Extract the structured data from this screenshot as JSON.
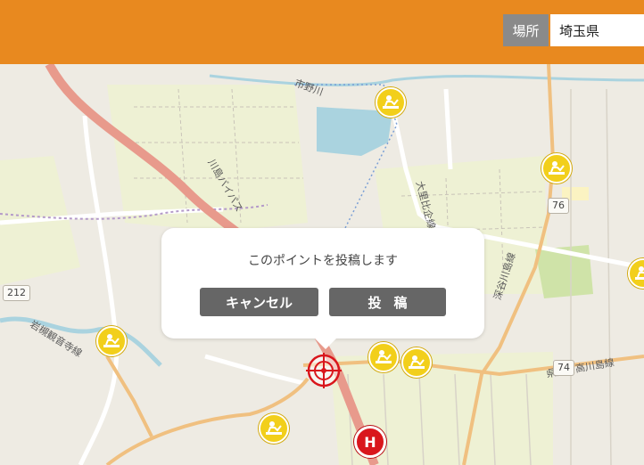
{
  "header": {
    "location_label": "場所",
    "location_value": "埼玉県"
  },
  "popup": {
    "message": "このポイントを投稿します",
    "cancel_label": "キャンセル",
    "post_label": "投稿"
  },
  "map": {
    "road_shields": [
      "76",
      "212",
      "74"
    ],
    "road_labels": [
      "大里比企線",
      "深谷川島線",
      "川島バイパス",
      "岩槻観音寺線",
      "県道日高川島線",
      "市野川"
    ],
    "hospital_symbol": "H"
  },
  "colors": {
    "header": "#e8891f",
    "location_label_bg": "#8a8a8a",
    "pin_yellow": "#f2cf1b",
    "button_gray": "#666666",
    "target_red": "#d9161c"
  }
}
